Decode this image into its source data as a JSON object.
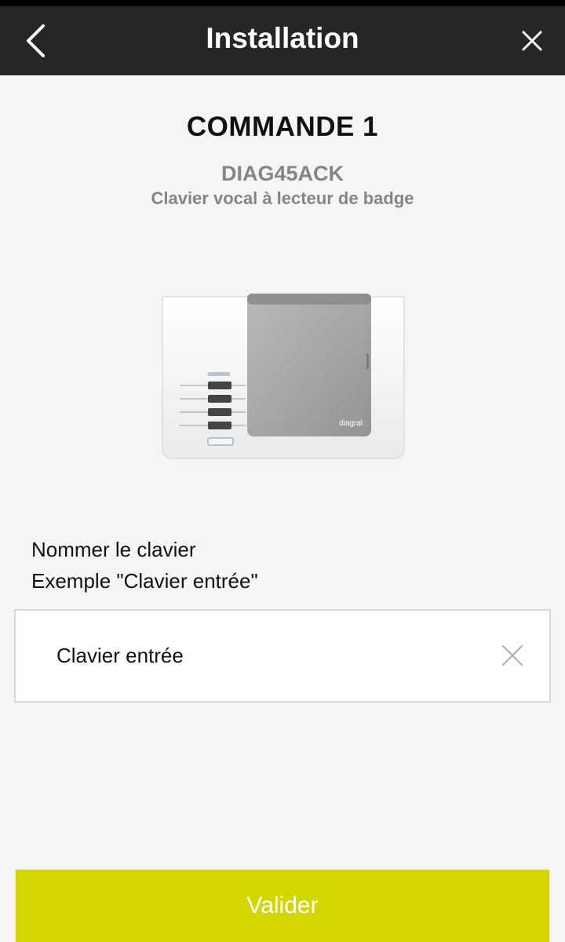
{
  "header": {
    "title": "Installation",
    "back_icon": "chevron-left-icon",
    "close_icon": "close-icon"
  },
  "device": {
    "title": "COMMANDE 1",
    "model": "DIAG45ACK",
    "description": "Clavier vocal à lecteur de badge",
    "brand_mark": "diagral"
  },
  "form": {
    "instruction_line1": "Nommer le clavier",
    "instruction_line2": "Exemple \"Clavier entrée\"",
    "name_value": "Clavier entrée",
    "clear_icon": "clear-icon"
  },
  "actions": {
    "validate_label": "Valider"
  },
  "colors": {
    "header_bg": "#262626",
    "accent": "#d3d600",
    "page_bg": "#f5f5f5"
  }
}
